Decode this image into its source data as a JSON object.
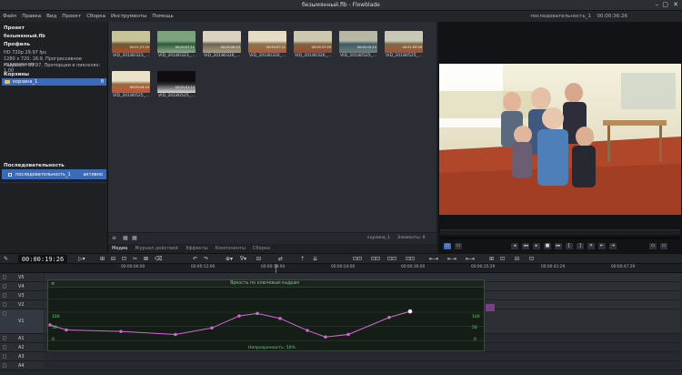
{
  "window": {
    "title": "безымянный.flb - Flowblade",
    "controls": [
      "–",
      "▢",
      "✕"
    ]
  },
  "menu": {
    "items": [
      "Файл",
      "Правка",
      "Вид",
      "Проект",
      "Сборка",
      "Инструменты",
      "Помощь"
    ],
    "sequence_name": "последовательность_1",
    "sequence_time": "00:00:36:26"
  },
  "project": {
    "header": "Проект",
    "filename": "безымянный.flb",
    "profile_header": "Профиль",
    "profile_lines": [
      "HD 720p 29.97 fps",
      "1280 x 720, 16:9, Прогрессивное кодирование",
      "Кадров/с: 29.97, Пропорции в пикселях: 1.00"
    ],
    "bins_header": "Корзины",
    "bin": {
      "name": "корзина_1",
      "count": "8"
    },
    "sequences_header": "Последовательность",
    "sequence": {
      "name": "последовательность_1",
      "state": "активно"
    }
  },
  "media": {
    "clips": [
      {
        "name": "VID_20180323_...",
        "duration": "00:01:27:29",
        "colors": [
          "#c8c39a",
          "#6b5a32",
          "#b54a22"
        ]
      },
      {
        "name": "VID_20180323_...",
        "duration": "00:00:07:11",
        "colors": [
          "#7da37e",
          "#2c5a3a",
          "#94a88a"
        ]
      },
      {
        "name": "VID_20180326_...",
        "duration": "00:00:06:23",
        "colors": [
          "#d9d2c0",
          "#6b6452",
          "#a79c7a"
        ]
      },
      {
        "name": "VID_20180326_...",
        "duration": "00:00:07:11",
        "colors": [
          "#e6ddc4",
          "#8a7350",
          "#b05a32"
        ]
      },
      {
        "name": "VID_20180326_...",
        "duration": "00:00:37:29",
        "colors": [
          "#cfc8b0",
          "#7e6242",
          "#9c4a2c"
        ]
      },
      {
        "name": "VID_20180525_...",
        "duration": "00:00:10:13",
        "colors": [
          "#b8b6a4",
          "#3d5b64",
          "#6e7f7a"
        ]
      },
      {
        "name": "VID_20180525_...",
        "duration": "00:01:05:09",
        "colors": [
          "#c9c7b6",
          "#7c6847",
          "#a7522f"
        ]
      },
      {
        "name": "VID_20180525_...",
        "duration": "00:00:44:14",
        "colors": [
          "#e9e2c8",
          "#9a6a3c",
          "#c3543a"
        ]
      },
      {
        "name": "VID_20180525_...",
        "duration": "00:00:01:14",
        "colors": [
          "#0e0e10",
          "#2a2a2e",
          "#dcdcdc"
        ]
      }
    ],
    "footer_bin": "корзина_1",
    "footer_items": "Элементы: 9",
    "tabs": [
      "Медиа",
      "Журнал действий",
      "Эффекты",
      "Компоненты",
      "Сборка"
    ]
  },
  "timeline": {
    "timecode": "00:00:19:26",
    "ruler_labels": [
      "00:00:06:00",
      "00:00:12:00",
      "00:00:18:00",
      "00:00:24:00",
      "00:00:30:00",
      "00:00:35:29",
      "00:00:41:29",
      "00:00:47:29"
    ],
    "video_tracks": [
      "V5",
      "V4",
      "V3",
      "V2",
      "V1"
    ],
    "audio_tracks": [
      "A1",
      "A2",
      "A3",
      "A4"
    ]
  },
  "keyframe_editor": {
    "title": "Яркость по ключевым кадрам",
    "footer_label": "Непрозрачность: 50%",
    "axis_left": [
      "100",
      "50",
      "0"
    ],
    "axis_right": [
      "100",
      "50",
      "0"
    ],
    "levels": [
      0.4,
      0.3,
      0.27,
      0.21,
      0.34,
      0.58,
      0.63,
      0.53,
      0.29,
      0.16,
      0.21,
      0.55,
      0.67
    ]
  },
  "colors": {
    "accent": "#3a6ab8",
    "keyframe_line": "#d36ad6",
    "curve_bg": "#151d17"
  }
}
